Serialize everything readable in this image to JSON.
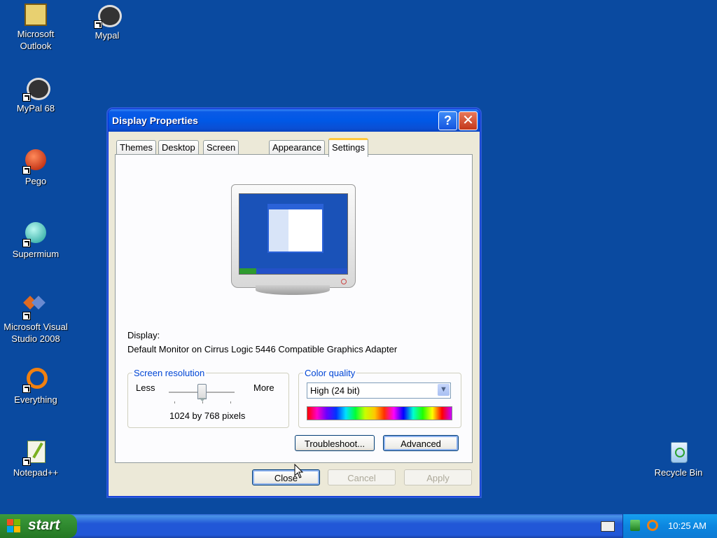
{
  "desktop": {
    "icons": [
      {
        "label_1": "Microsoft",
        "label_2": "Outlook",
        "icon": "outlook-icon"
      },
      {
        "label_1": "Mypal",
        "icon": "mypal-icon"
      },
      {
        "label_1": "MyPal 68",
        "icon": "mypal68-icon"
      },
      {
        "label_1": "Pego",
        "icon": "pego-icon"
      },
      {
        "label_1": "Supermium",
        "icon": "supermium-icon"
      },
      {
        "label_1": "Microsoft Visual",
        "label_2": "Studio 2008",
        "icon": "visual-studio-icon"
      },
      {
        "label_1": "Everything",
        "icon": "everything-icon"
      },
      {
        "label_1": "Notepad++",
        "icon": "notepadpp-icon"
      },
      {
        "label_1": "Recycle Bin",
        "icon": "recycle-bin-icon"
      }
    ]
  },
  "window": {
    "title": "Display Properties",
    "help_glyph": "?",
    "close_glyph": "✕",
    "tabs": [
      "Themes",
      "Desktop",
      "Screen Saver",
      "Appearance",
      "Settings"
    ],
    "active_tab": "Settings",
    "display_label": "Display:",
    "display_value": "Default Monitor on Cirrus Logic 5446 Compatible Graphics Adapter",
    "resolution": {
      "legend": "Screen resolution",
      "less": "Less",
      "more": "More",
      "value": "1024 by 768 pixels"
    },
    "color_quality": {
      "legend": "Color quality",
      "selected": "High (24 bit)"
    },
    "buttons": {
      "troubleshoot": "Troubleshoot...",
      "advanced": "Advanced",
      "close": "Close",
      "cancel": "Cancel",
      "apply": "Apply"
    }
  },
  "taskbar": {
    "start_label": "start",
    "clock": "10:25 AM"
  }
}
